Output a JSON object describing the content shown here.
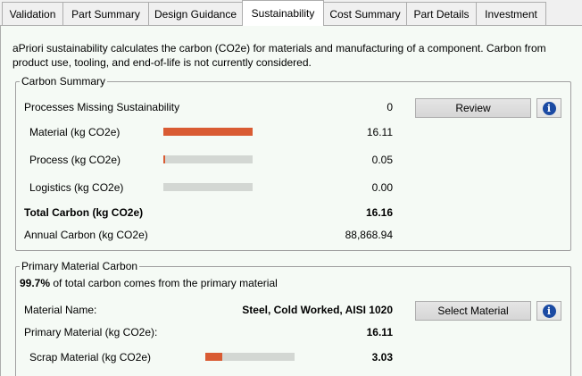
{
  "tabs": [
    {
      "label": "Validation"
    },
    {
      "label": "Part Summary"
    },
    {
      "label": "Design Guidance"
    },
    {
      "label": "Sustainability",
      "active": true
    },
    {
      "label": "Cost Summary"
    },
    {
      "label": "Part Details"
    },
    {
      "label": "Investment"
    }
  ],
  "intro": "aPriori sustainability calculates the carbon (CO2e) for materials and manufacturing of a component. Carbon from product use, tooling, and end-of-life is not currently considered.",
  "carbon_summary": {
    "legend": "Carbon Summary",
    "missing_label": "Processes Missing Sustainability",
    "missing_value": "0",
    "review_button": "Review",
    "info_icon": "info-icon",
    "material_label": "Material (kg CO2e)",
    "material_value": "16.11",
    "material_fraction": 0.997,
    "process_label": "Process (kg CO2e)",
    "process_value": "0.05",
    "process_fraction": 0.01,
    "logistics_label": "Logistics (kg CO2e)",
    "logistics_value": "0.00",
    "logistics_fraction": 0.0,
    "total_label": "Total Carbon (kg CO2e)",
    "total_value": "16.16",
    "annual_label": "Annual Carbon (kg CO2e)",
    "annual_value": "88,868.94"
  },
  "primary_material": {
    "legend": "Primary Material Carbon",
    "percent": "99.7%",
    "percent_text": " of total carbon comes from the primary material",
    "material_name_label": "Material Name:",
    "material_name_value": "Steel, Cold Worked, AISI 1020",
    "select_button": "Select Material",
    "primary_label": "Primary Material (kg CO2e):",
    "primary_value": "16.11",
    "scrap_label": "Scrap Material (kg CO2e)",
    "scrap_value": "3.03",
    "scrap_fraction": 0.19
  },
  "colors": {
    "bar_fill": "#d95b33",
    "bar_track": "#d3d7d3",
    "info_icon": "#1b4aa3",
    "panel_background": "#f5faf5"
  }
}
